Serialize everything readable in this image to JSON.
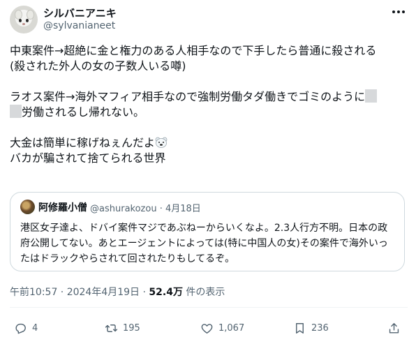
{
  "author": {
    "display_name": "シルバニアニキ",
    "handle": "@sylvanianeet"
  },
  "tweet": {
    "line1": "中東案件→超絶に金と権力のある人相手なので下手したら普通に殺される",
    "line2": "(殺された外人の女の子数人いる噂)",
    "line3a": "ラオス案件→海外マフィア相手なので強制労働タダ働きでゴミのように",
    "line4b": "労働されるし帰れない。",
    "line5": "大金は簡単に稼げねぇんだよ",
    "line6": "バカが騙されて捨てられる世界"
  },
  "quote": {
    "display_name": "阿修羅小僧",
    "meta": "@ashurakozou · 4月18日",
    "text": "港区女子達よ、ドバイ案件マジであぶねーからいくなよ。2.3人行方不明。日本の政府公開してない。あとエージェントによっては(特に中国人の女)その案件で海外いったはドラックやらされて回されたりもしてるぞ。"
  },
  "meta": {
    "time_date": "午前10:57 · 2024年4月19日 · ",
    "views_count": "52.4万",
    "views_label": " 件の表示"
  },
  "actions": {
    "replies": "4",
    "reposts": "195",
    "likes": "1,067",
    "bookmarks": "236"
  },
  "colors": {
    "text": "#0f1419",
    "secondary": "#536471",
    "border": "#cfd9de"
  }
}
